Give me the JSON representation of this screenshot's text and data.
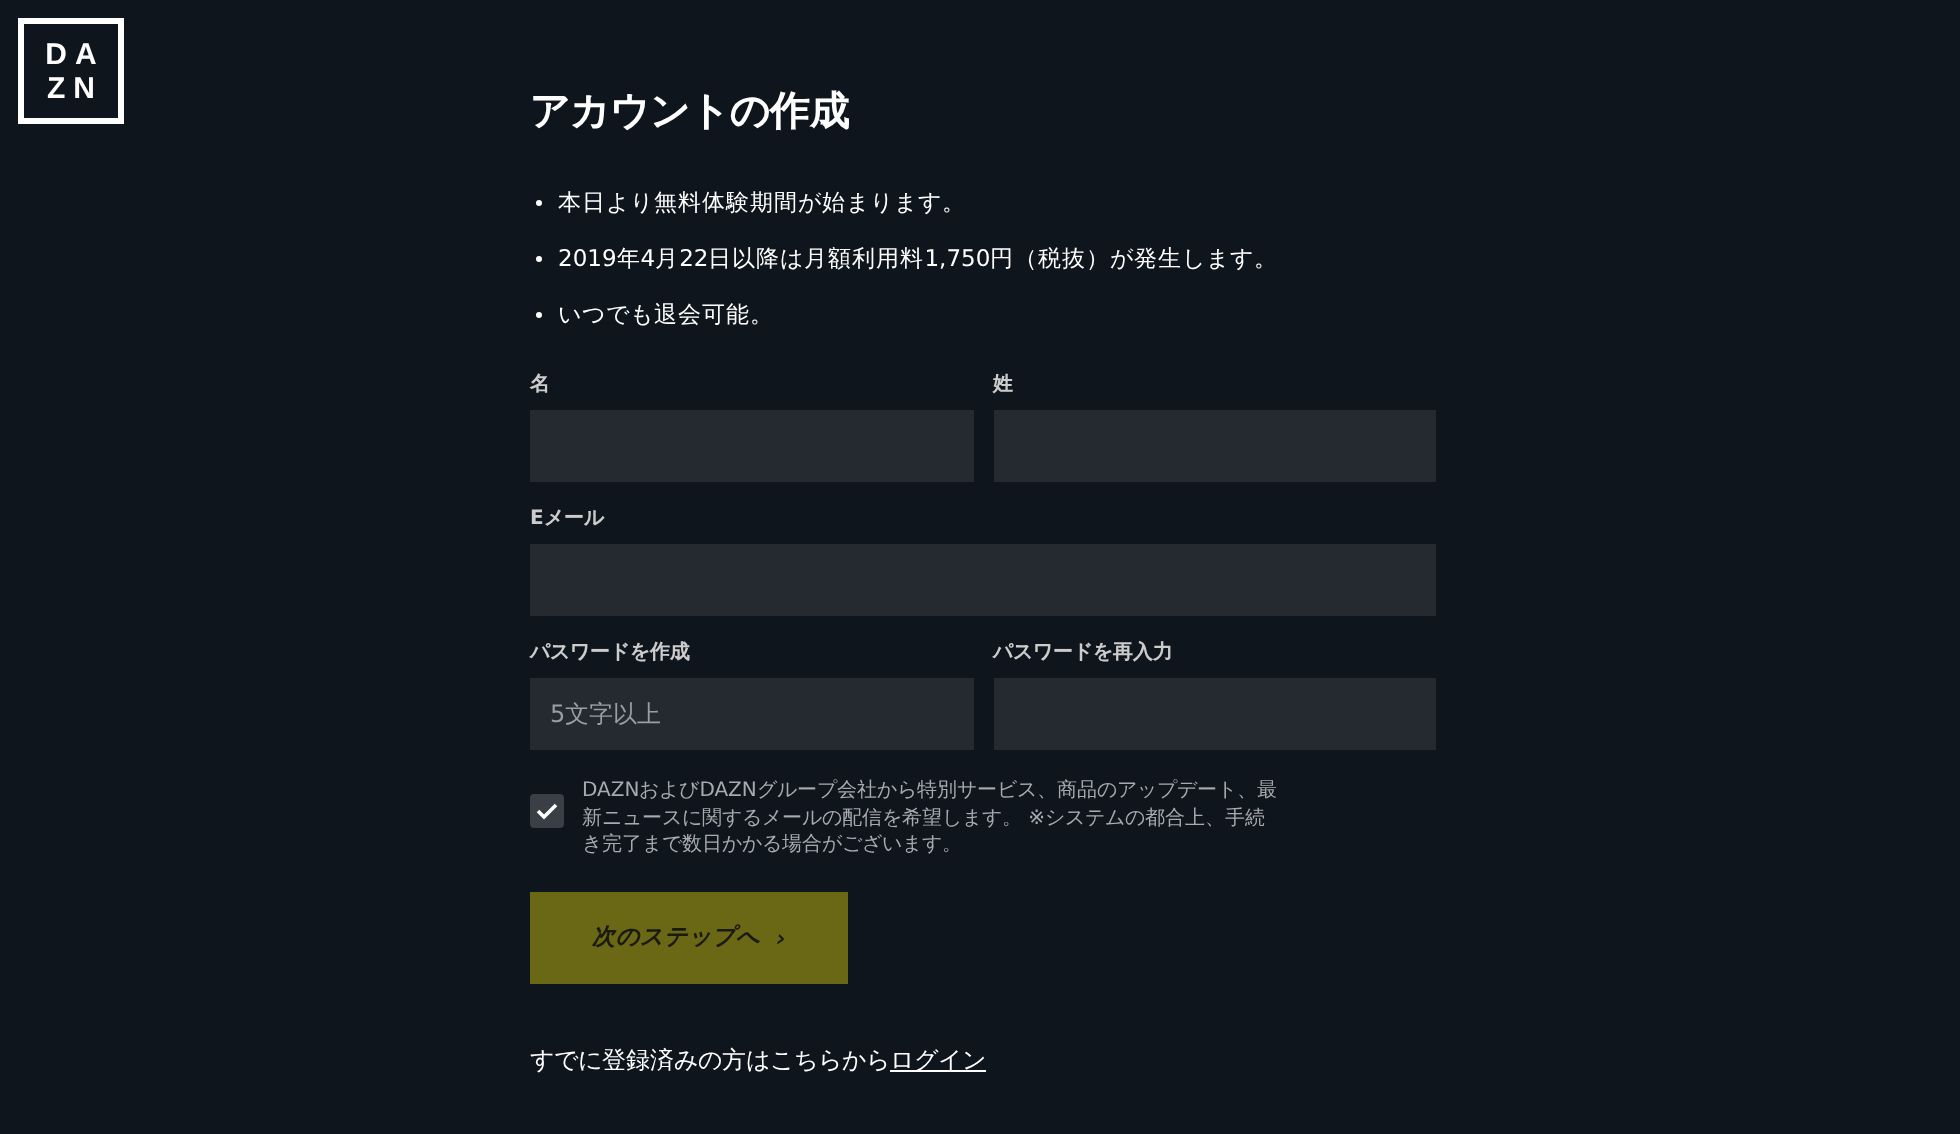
{
  "logo": {
    "top": "DA",
    "bottom": "ZN"
  },
  "title": "アカウントの作成",
  "bullets": [
    "本日より無料体験期間が始まります。",
    "2019年4月22日以降は月額利用料1,750円（税抜）が発生します。",
    "いつでも退会可能。"
  ],
  "field_rows": [
    [
      {
        "label": "名"
      },
      {
        "label": "姓"
      }
    ],
    [
      {
        "label": "Eメール"
      }
    ],
    [
      {
        "label": "パスワードを作成",
        "placeholder": "5文字以上"
      },
      {
        "label": "パスワードを再入力"
      }
    ]
  ],
  "consent": {
    "checked": true,
    "text": "DAZNおよびDAZNグループ会社から特別サービス、商品のアップデート、最新ニュースに関するメールの配信を希望します。 ※システムの都合上、手続き完了まで数日かかる場合がございます。"
  },
  "next_button": {
    "label": "次のステップへ",
    "icon": "›"
  },
  "login": {
    "text": "すでに登録済みの方はこちらから",
    "link": "ログイン"
  }
}
